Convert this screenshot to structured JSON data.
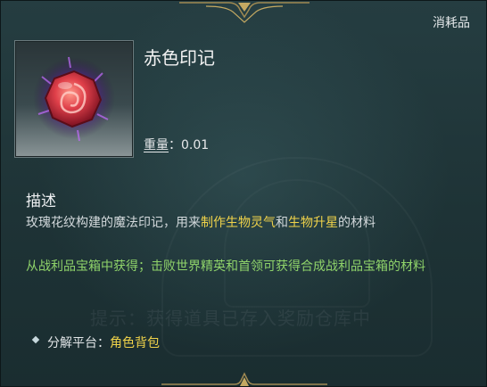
{
  "category": "消耗品",
  "item": {
    "name": "赤色印记",
    "weight_label": "重量",
    "weight_sep": "：",
    "weight_value": "0.01",
    "icon": "red-rose-gem-icon"
  },
  "description": {
    "heading": "描述",
    "part1": "玫瑰花纹构建的魔法印记，用来",
    "highlight1": "制作生物灵气",
    "part2": "和",
    "highlight2": "生物升星",
    "part3": "的材料"
  },
  "source_text": "从战利品宝箱中获得；击败世界精英和首领可获得合成战利品宝箱的材料",
  "background_hint": "提示：获得道具已存入奖励仓库中",
  "decompose": {
    "label": "分解平台：",
    "value": "角色背包"
  },
  "colors": {
    "highlight": "#f0d34a",
    "green": "#8fd36a",
    "background": "#1f3437"
  }
}
